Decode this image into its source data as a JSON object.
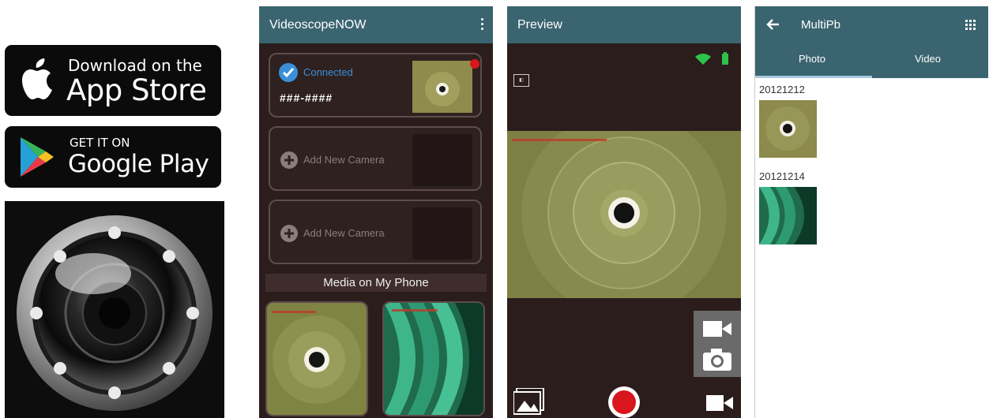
{
  "badges": {
    "appstore": {
      "line1": "Download on the",
      "line2": "App Store",
      "icon": "apple-logo-icon"
    },
    "googleplay": {
      "line1": "GET IT ON",
      "line2": "Google Play",
      "icon": "play-triangle-icon"
    }
  },
  "app_icon": {
    "icon": "camera-lens-icon"
  },
  "screen_home": {
    "title": "VideoscopeNOW",
    "menu_icon": "kebab-menu-icon",
    "cameras": [
      {
        "status": "Connected",
        "name": "###-####",
        "icon": "check-circle-icon"
      },
      {
        "label": "Add New Camera",
        "icon": "plus-circle-icon"
      },
      {
        "label": "Add New Camera",
        "icon": "plus-circle-icon"
      }
    ],
    "media_header": "Media on My Phone"
  },
  "screen_preview": {
    "title": "Preview",
    "status_icons": [
      "wifi-icon",
      "battery-icon"
    ],
    "controls": [
      "video-mode-icon",
      "photo-mode-icon",
      "gallery-icon",
      "record-button-icon",
      "video-icon"
    ],
    "colors": {
      "record": "#d8161b"
    }
  },
  "screen_multipb": {
    "title": "MultiPb",
    "tabs": [
      "Photo",
      "Video"
    ],
    "groups": [
      {
        "date": "20121212"
      },
      {
        "date": "20121214"
      }
    ]
  },
  "colors": {
    "appbar": "#3a6470",
    "phone_bg": "#2b1d1c",
    "accent_blue": "#3b8fd9"
  }
}
